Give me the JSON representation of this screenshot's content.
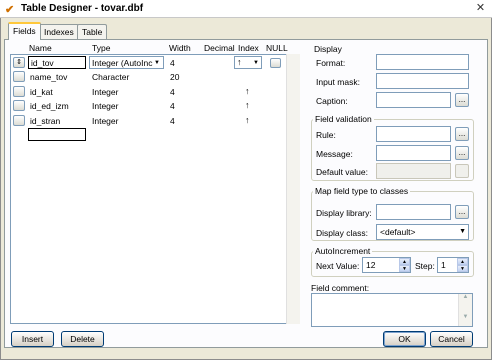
{
  "window": {
    "title": "Table Designer - tovar.dbf"
  },
  "tabs": [
    "Fields",
    "Indexes",
    "Table"
  ],
  "grid": {
    "headers": {
      "name": "Name",
      "type": "Type",
      "width": "Width",
      "decimal": "Decimal",
      "index": "Index",
      "null": "NULL"
    },
    "rows": [
      {
        "name": "id_tov",
        "type": "Integer (AutoInc",
        "width": "4",
        "index": "↑",
        "selected": true
      },
      {
        "name": "name_tov",
        "type": "Character",
        "width": "20",
        "index": ""
      },
      {
        "name": "id_kat",
        "type": "Integer",
        "width": "4",
        "index": "↑"
      },
      {
        "name": "id_ed_izm",
        "type": "Integer",
        "width": "4",
        "index": "↑"
      },
      {
        "name": "id_stran",
        "type": "Integer",
        "width": "4",
        "index": "↑"
      },
      {
        "name": "",
        "type": "",
        "width": "",
        "index": ""
      }
    ],
    "mover_glyph": "⇕"
  },
  "display": {
    "title": "Display",
    "format_label": "Format:",
    "input_mask_label": "Input mask:",
    "caption_label": "Caption:"
  },
  "field_validation": {
    "title": "Field validation",
    "rule_label": "Rule:",
    "message_label": "Message:",
    "default_value_label": "Default value:"
  },
  "map_field_type": {
    "title": "Map field type to classes",
    "display_library_label": "Display library:",
    "display_class_label": "Display class:",
    "display_class_value": "<default>"
  },
  "autoincrement": {
    "title": "AutoIncrement",
    "next_value_label": "Next Value:",
    "next_value": "12",
    "step_label": "Step:",
    "step_value": "1"
  },
  "field_comment": {
    "label": "Field comment:"
  },
  "buttons": {
    "insert": "Insert",
    "delete": "Delete",
    "ok": "OK",
    "cancel": "Cancel",
    "ellipsis": "..."
  }
}
